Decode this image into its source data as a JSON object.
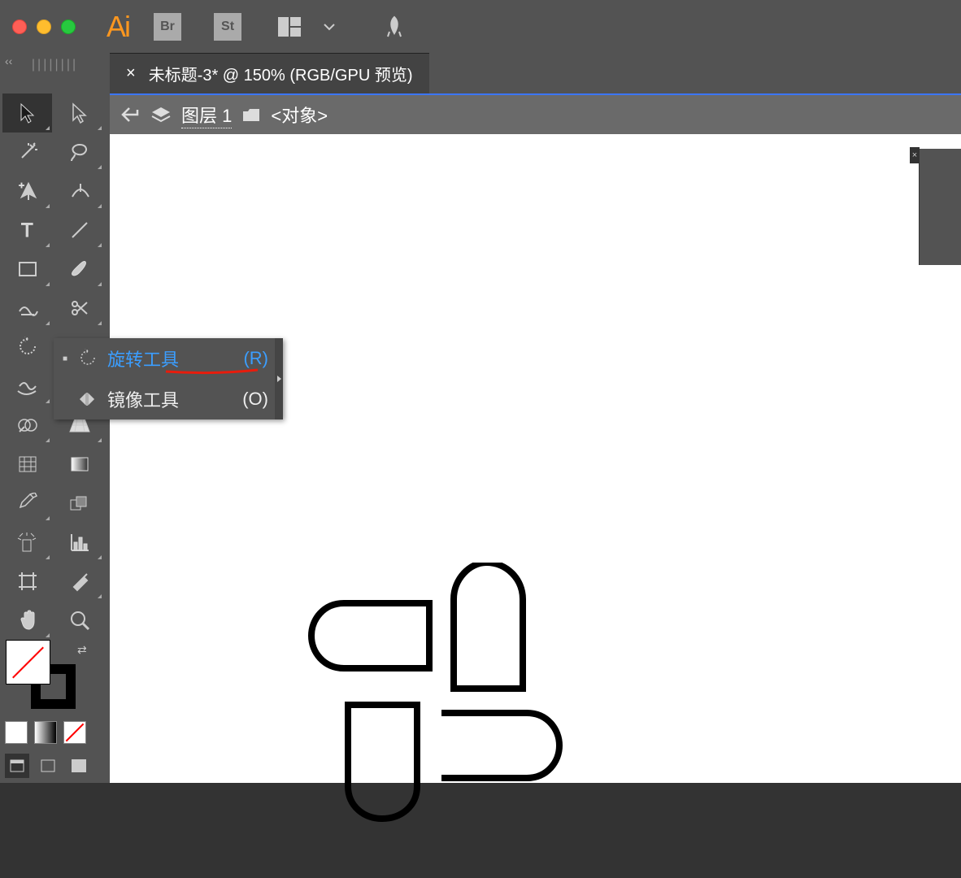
{
  "app": {
    "logo": "Ai",
    "br_label": "Br",
    "st_label": "St"
  },
  "tab": {
    "close": "×",
    "title": "未标题-3* @ 150% (RGB/GPU 预览)"
  },
  "layer_bar": {
    "layer_prefix": "图层",
    "layer_num": "1",
    "object": "<对象>"
  },
  "flyout": {
    "rotate": {
      "label": "旋转工具",
      "key": "(R)"
    },
    "reflect": {
      "label": "镜像工具",
      "key": "(O)"
    }
  },
  "panel": {
    "chevrons": "‹‹",
    "grip": "||||||||"
  },
  "side_peek": {
    "x": "×"
  }
}
